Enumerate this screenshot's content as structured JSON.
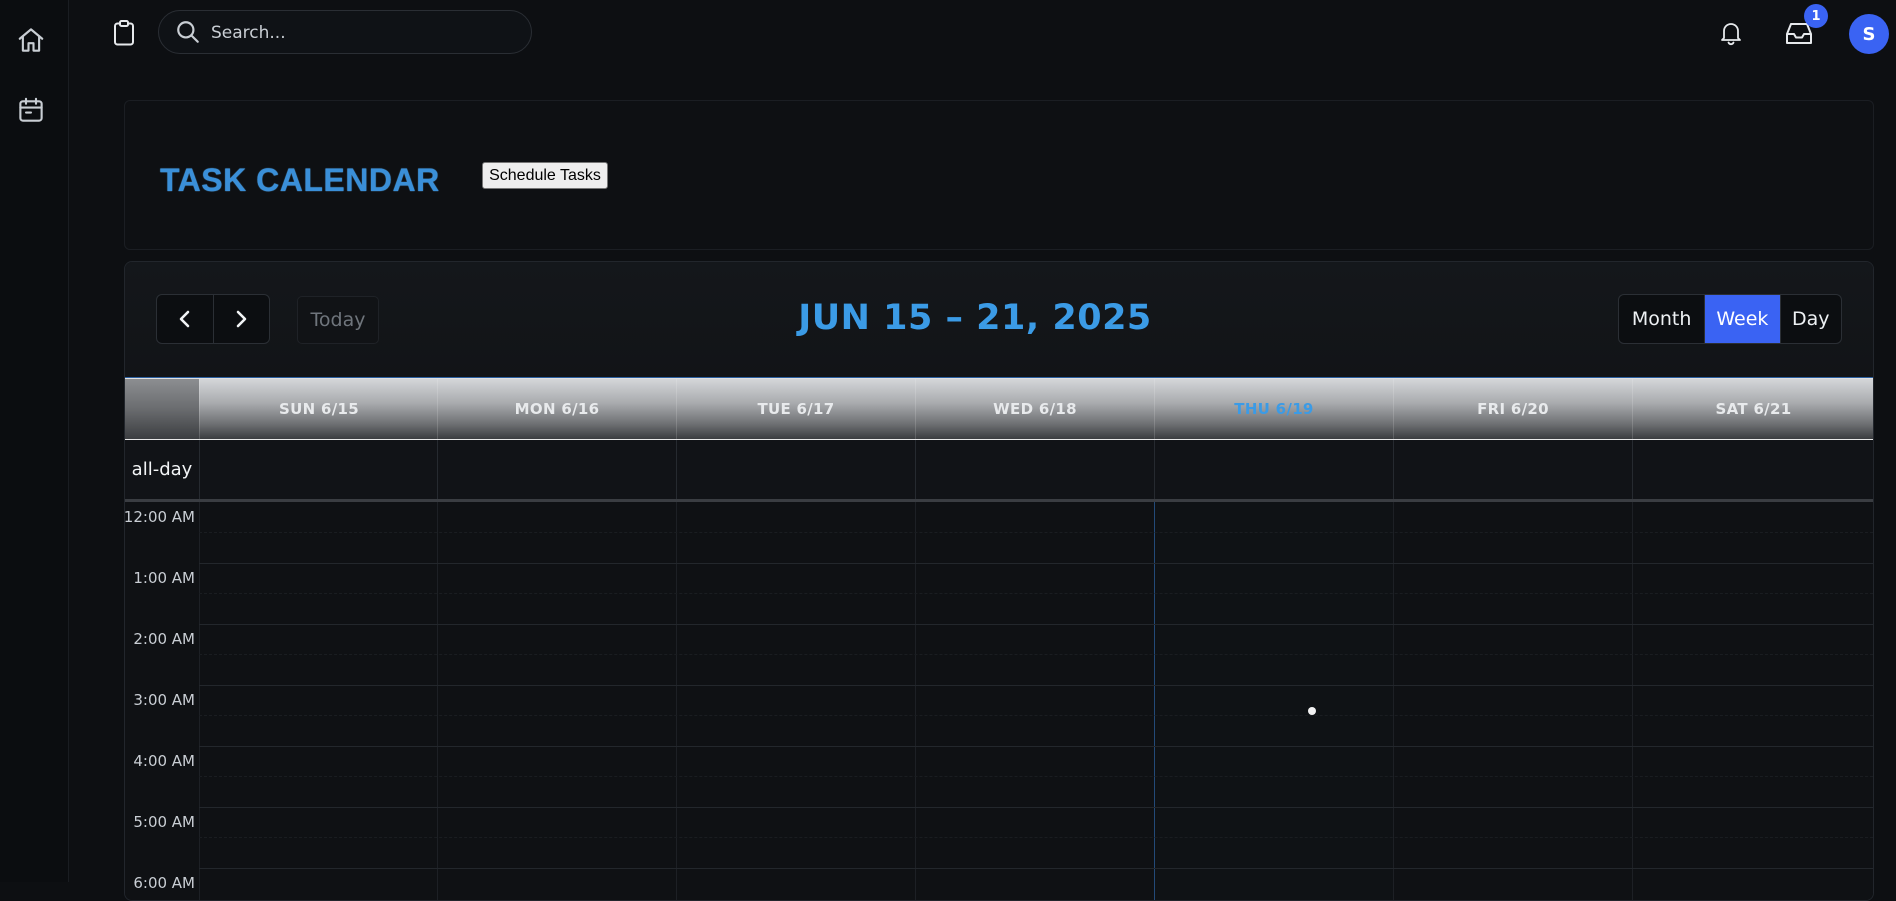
{
  "search": {
    "placeholder": "Search..."
  },
  "notifications": {
    "inbox_badge": "1"
  },
  "user": {
    "avatar_initial": "S"
  },
  "header": {
    "title": "TASK CALENDAR",
    "schedule_button": "Schedule Tasks"
  },
  "calendar": {
    "today_label": "Today",
    "range_title": "JUN 15 – 21, 2025",
    "views": {
      "month": "Month",
      "week": "Week",
      "day": "Day"
    },
    "active_view": "Week",
    "days": [
      "SUN 6/15",
      "MON 6/16",
      "TUE 6/17",
      "WED 6/18",
      "THU 6/19",
      "FRI 6/20",
      "SAT 6/21"
    ],
    "today_index": 4,
    "all_day_label": "all-day",
    "times": [
      "12:00 AM",
      "1:00 AM",
      "2:00 AM",
      "3:00 AM",
      "4:00 AM",
      "5:00 AM",
      "6:00 AM"
    ]
  },
  "colors": {
    "accent": "#3a63f3",
    "title_blue": "#3b9be6",
    "background": "#0d0f12"
  },
  "icons": [
    "home-icon",
    "calendar-icon",
    "clipboard-icon",
    "search-icon",
    "bell-icon",
    "inbox-icon",
    "chevron-left-icon",
    "chevron-right-icon"
  ]
}
